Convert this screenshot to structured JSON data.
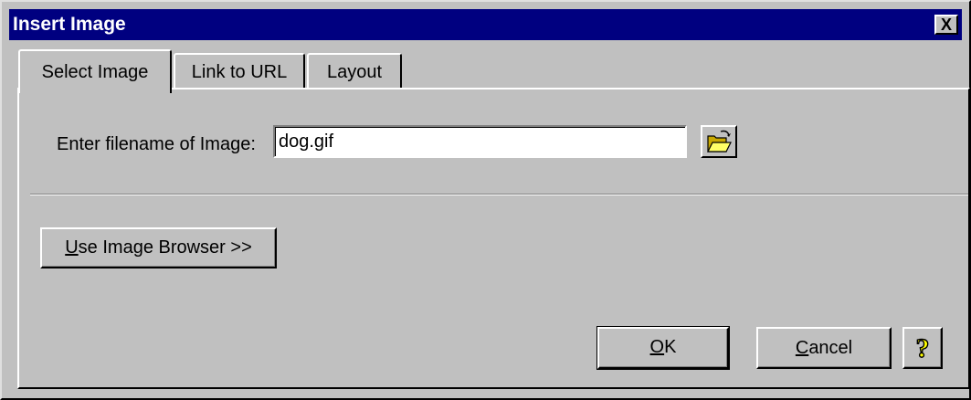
{
  "window": {
    "title": "Insert Image",
    "close_label": "X"
  },
  "tabs": [
    {
      "label": "Select Image",
      "active": true
    },
    {
      "label": "Link to URL",
      "active": false
    },
    {
      "label": "Layout",
      "active": false
    }
  ],
  "form": {
    "filename_label": "Enter filename of Image:",
    "filename_value": "dog.gif",
    "browse_icon": "open-folder-icon"
  },
  "buttons": {
    "image_browser_mnemonic": "U",
    "image_browser_rest": "se Image Browser >>",
    "ok_mnemonic": "O",
    "ok_rest": "K",
    "cancel_mnemonic": "C",
    "cancel_rest": "ancel",
    "help_icon": "question-mark-icon"
  },
  "colors": {
    "face": "#c0c0c0",
    "titlebar": "#000080",
    "title_text": "#ffffff",
    "help_question": "#ffff00"
  }
}
